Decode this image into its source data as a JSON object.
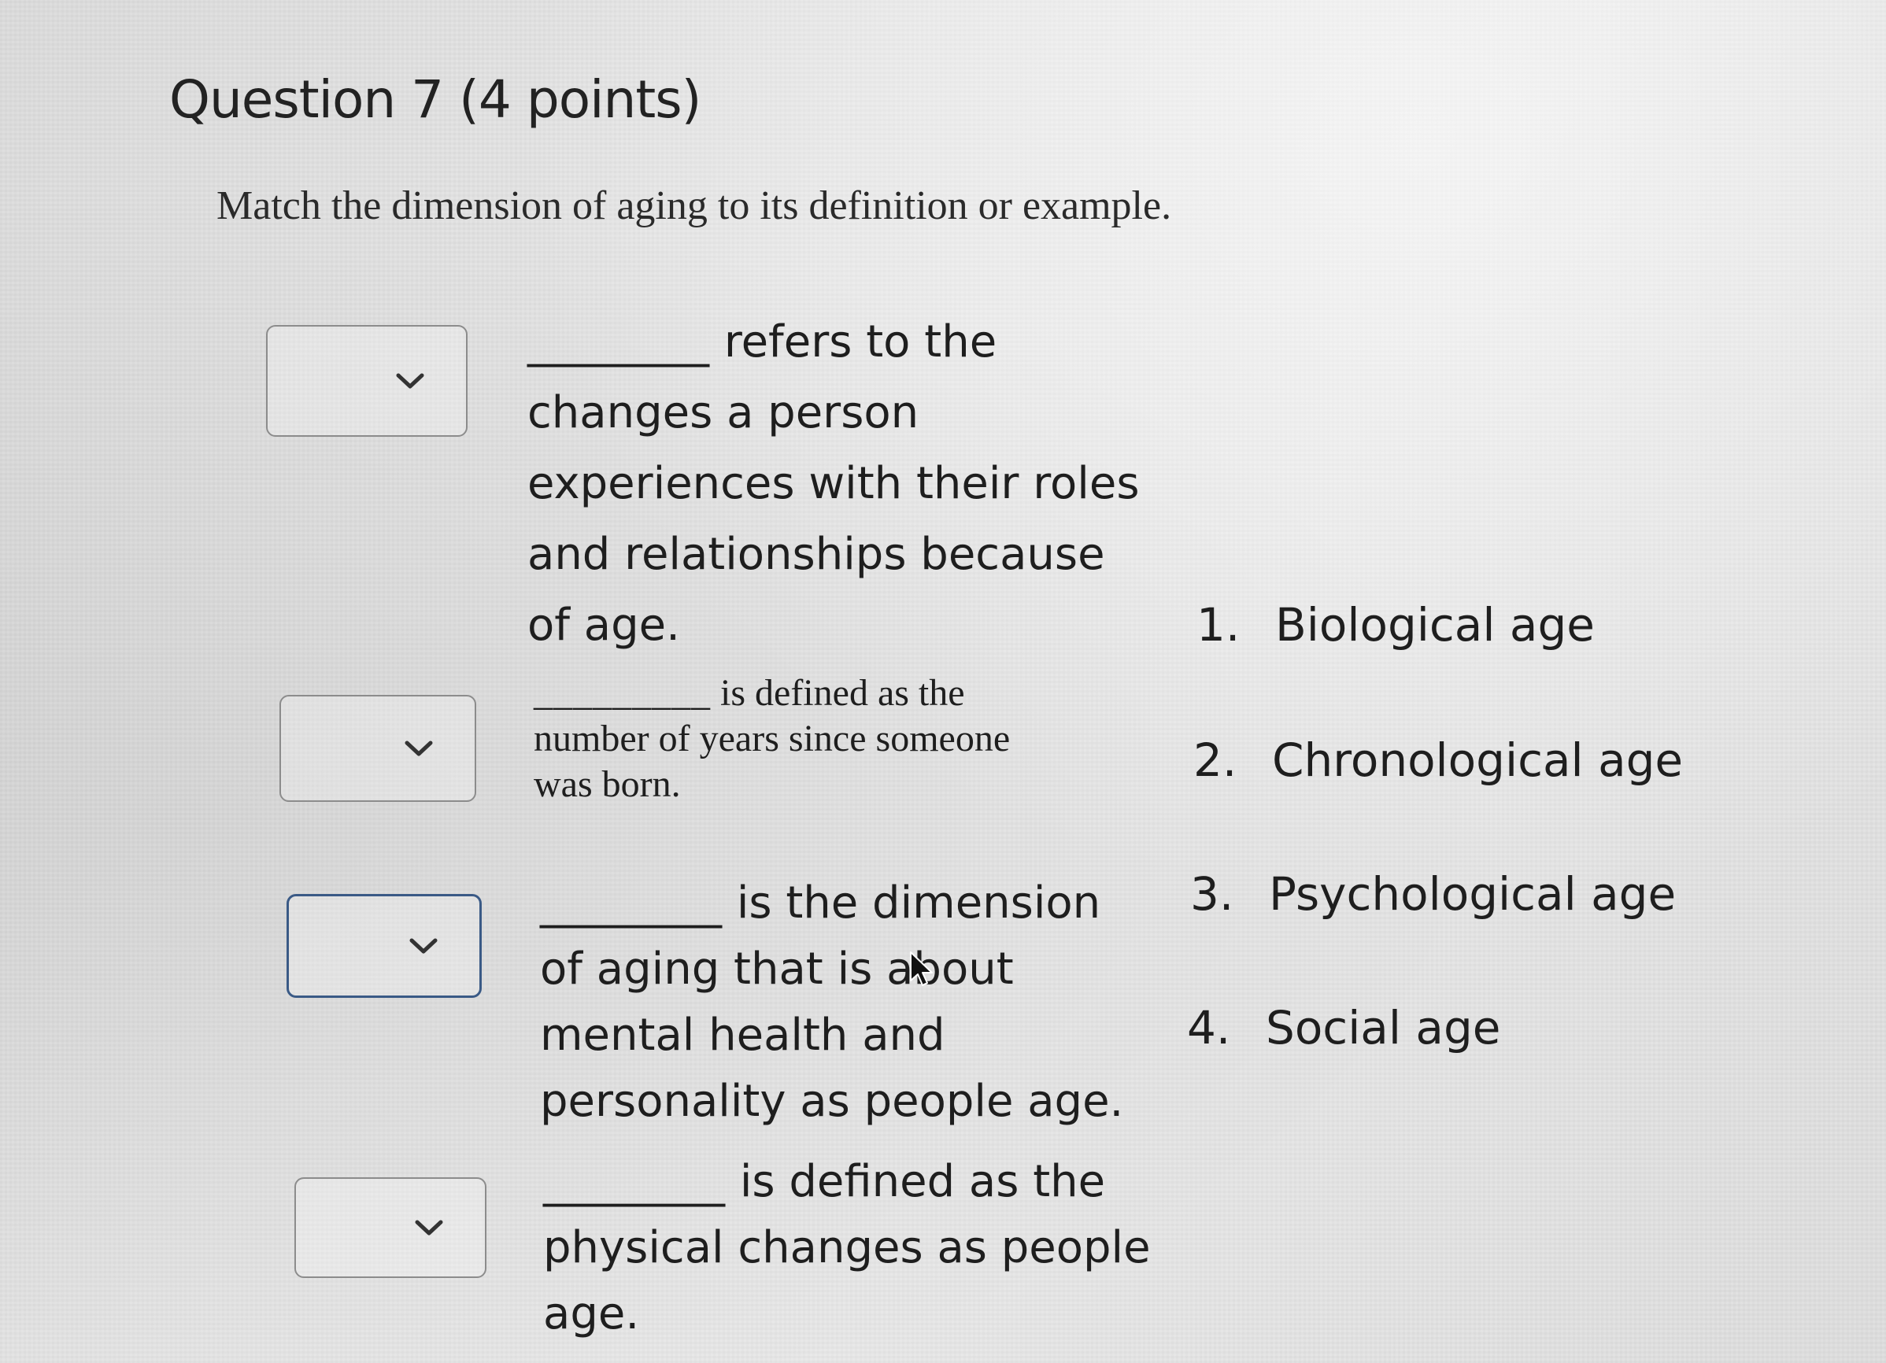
{
  "question": {
    "title": "Question 7",
    "points": "(4 points)",
    "prompt": "Match the dimension of aging to its definition or example."
  },
  "statements": [
    {
      "blank": "________",
      "lines": [
        "refers to the",
        "changes a person",
        "experiences with their roles",
        "and relationships because",
        "of age."
      ]
    },
    {
      "blank": "_________",
      "lines": [
        "is defined as the",
        "number of years since someone",
        "was born."
      ]
    },
    {
      "blank": "________",
      "lines": [
        "is the dimension",
        "of aging that is about",
        "mental health and",
        "personality as people age."
      ]
    },
    {
      "blank": "________",
      "lines": [
        "is defined as the",
        "physical changes as people",
        "age."
      ]
    }
  ],
  "dropdowns": [
    {
      "selected": "",
      "icon": "chevron-down-icon"
    },
    {
      "selected": "",
      "icon": "chevron-down-icon"
    },
    {
      "selected": "",
      "icon": "chevron-down-icon",
      "focused": true
    },
    {
      "selected": "",
      "icon": "chevron-down-icon"
    }
  ],
  "answers": [
    {
      "num": "1.",
      "label": "Biological age"
    },
    {
      "num": "2.",
      "label": "Chronological age"
    },
    {
      "num": "3.",
      "label": "Psychological age"
    },
    {
      "num": "4.",
      "label": "Social age"
    }
  ],
  "colors": {
    "focus_border": "#3a5a86",
    "border": "#8c8c8c",
    "text": "#1e1e1e"
  }
}
